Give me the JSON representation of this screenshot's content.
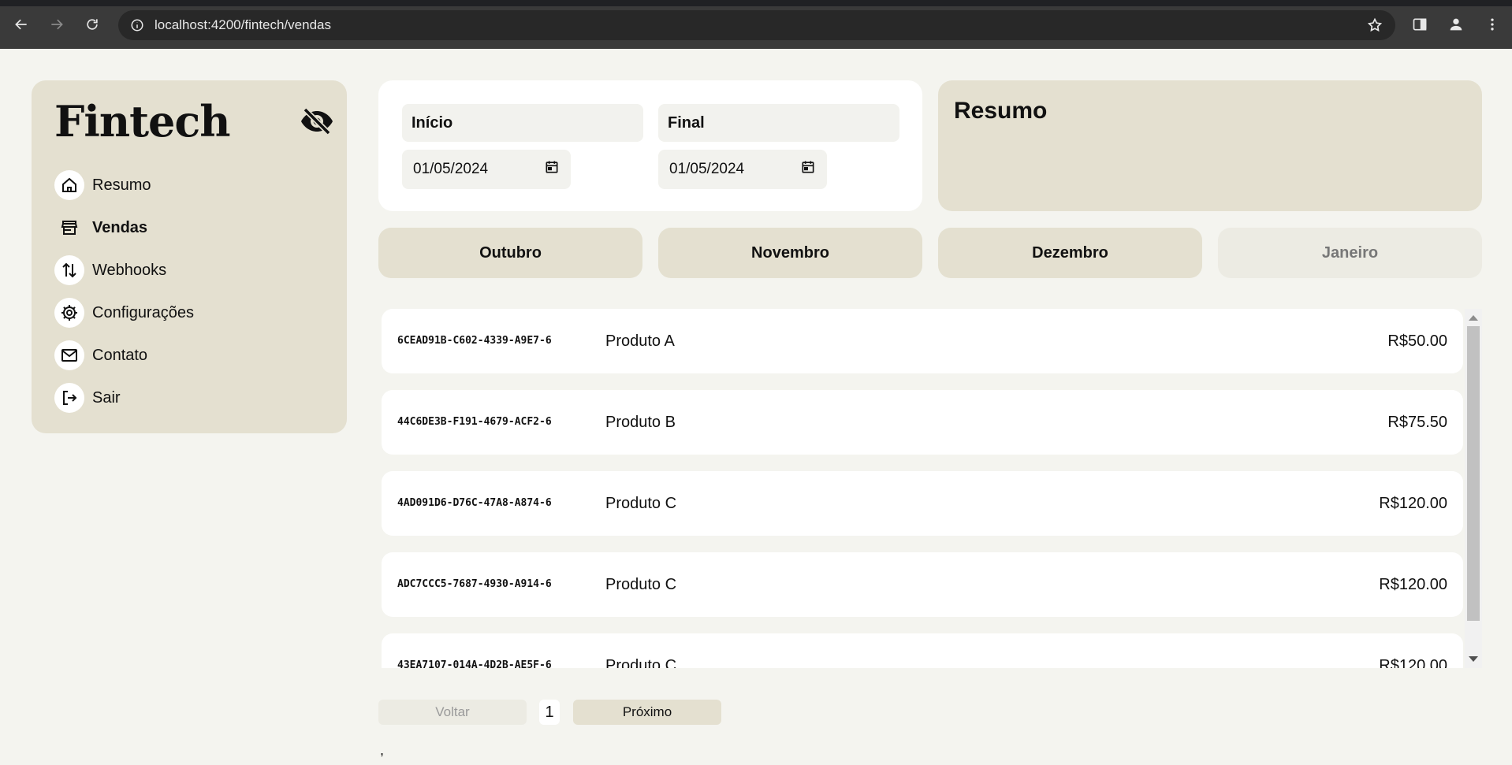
{
  "browser": {
    "url": "localhost:4200/fintech/vendas"
  },
  "sidebar": {
    "logo": "Fintech",
    "items": [
      {
        "label": "Resumo",
        "icon": "home-icon"
      },
      {
        "label": "Vendas",
        "icon": "store-icon",
        "active": true
      },
      {
        "label": "Webhooks",
        "icon": "arrows-up-down-icon"
      },
      {
        "label": "Configurações",
        "icon": "gear-icon"
      },
      {
        "label": "Contato",
        "icon": "mail-icon"
      },
      {
        "label": "Sair",
        "icon": "logout-icon"
      }
    ]
  },
  "filters": {
    "start_label": "Início",
    "start_value": "01/05/2024",
    "end_label": "Final",
    "end_value": "01/05/2024"
  },
  "summary": {
    "title": "Resumo"
  },
  "months": [
    "Outubro",
    "Novembro",
    "Dezembro",
    "Janeiro"
  ],
  "sales": [
    {
      "id": "6CEAD91B-C602-4339-A9E7-6",
      "product": "Produto A",
      "value": "R$50.00"
    },
    {
      "id": "44C6DE3B-F191-4679-ACF2-6",
      "product": "Produto B",
      "value": "R$75.50"
    },
    {
      "id": "4AD091D6-D76C-47A8-A874-6",
      "product": "Produto C",
      "value": "R$120.00"
    },
    {
      "id": "ADC7CCC5-7687-4930-A914-6",
      "product": "Produto C",
      "value": "R$120.00"
    },
    {
      "id": "43EA7107-014A-4D2B-AE5F-6",
      "product": "Produto C",
      "value": "R$120.00"
    }
  ],
  "pagination": {
    "prev_label": "Voltar",
    "page": "1",
    "next_label": "Próximo"
  },
  "footer_text": ",",
  "colors": {
    "background": "#f4f4ef",
    "panel": "#e4e0d0",
    "card": "#ffffff",
    "chrome": "#3a3a3a"
  }
}
